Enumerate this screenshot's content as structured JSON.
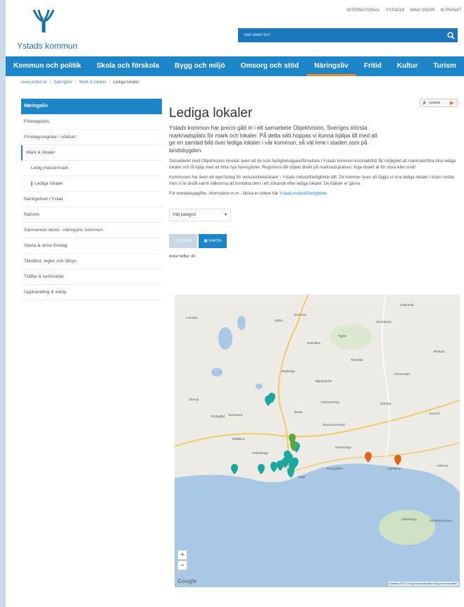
{
  "header": {
    "logo_text": "Ystads kommun",
    "top_links": [
      "INTERNATIONAL",
      "YSTAD24",
      "MINA SIDOR",
      "INTRANAT"
    ],
    "search_placeholder": "Vad söker du?"
  },
  "nav": {
    "items": [
      "Kommun och politik",
      "Skola och förskola",
      "Bygg och miljö",
      "Omsorg och stöd",
      "Näringsliv",
      "Fritid",
      "Kultur",
      "Turism"
    ],
    "active_index": 4
  },
  "breadcrumb": [
    "www.ystad.se",
    "Näringsliv",
    "Mark & lokaler",
    "Lediga lokaler"
  ],
  "sidebar": {
    "heading": "Näringsliv",
    "items": [
      {
        "label": "Företagslots",
        "level": 0
      },
      {
        "label": "Företagsregister / sökbart",
        "level": 0
      },
      {
        "label": "Mark & lokaler",
        "level": 0,
        "open": true
      },
      {
        "label": "Ledig industrimark",
        "level": 1
      },
      {
        "label": "Lediga lokaler",
        "level": 1,
        "active": true
      },
      {
        "label": "Näringslivet i Ystad",
        "level": 0
      },
      {
        "label": "Nätverk",
        "level": 0
      },
      {
        "label": "Samverkan skola - näringsliv- kommun",
        "level": 0
      },
      {
        "label": "Starta & driva företag",
        "level": 0
      },
      {
        "label": "Tillstånd, regler och tillsyn",
        "level": 0
      },
      {
        "label": "Träffar & seminarier",
        "level": 0
      },
      {
        "label": "Upphandling & inköp",
        "level": 0
      }
    ]
  },
  "main": {
    "listen_label": "Lyssna",
    "title": "Lediga lokaler",
    "lead": "Ystads kommun har precis gått in i ett samarbete Objektvision, Sveriges största marknadsplats för mark och lokaler. På detta sätt hoppas vi kunna hjälpa till med att ge en samlad bild över lediga lokaler i vår kommun, så väl inne i staden som på landsbygden.",
    "para1": "Samarbetet med Objektvision innebär även att du som fastighetsägare/förvaltare i Ystads kommun kostnadsfritt får möjlighet att marknadsföra dina lediga lokaler och få hjälp med att hitta nya hyresgäster. Registrera ditt objekt direkt på marknadsplatsen. Inga objekt är för stora eller små!",
    "para2": "Kommunen har även ett eget bolag för verksamhetslokaler - Ystads Industrifastigheter AB. De kommer även att lägga ut sina lediga lokaler i listan nedan men ni är ändå varmt välkomna att kontakta dem i ert sökande efter lediga lokaler. De hjälper er gärna.",
    "para3_text": "För kontaktuppgifter, information m.m - klicka er vidare här",
    "para3_link": "Ystads Industrifastigheter.",
    "select_value": "Välj kategori",
    "btn_lista": "LISTA",
    "btn_karta": "KARTA",
    "count_text": "Antal träffar: 40"
  },
  "map": {
    "labels": [
      "Onslunda",
      "Tomelilla",
      "Brösarp",
      "Sjöbo",
      "Ramsåsa",
      "Lunnarp",
      "Tyghe",
      "Kverrestad",
      "Smedstorp",
      "Baldringe",
      "Bjärsjöholm",
      "Östraby",
      "Everöd",
      "Hammenhög",
      "Hedeskoga",
      "Ystad",
      "Glemminge",
      "Ingelstorp",
      "Kåseberga",
      "Löderup",
      "Svenstorp",
      "Skurup",
      "Rydsgård",
      "Balkåkra",
      "Köpingebro",
      "Sandhammaren",
      "Stora Herrestad",
      "Borrie",
      "Bromma"
    ],
    "zoom_in": "+",
    "zoom_out": "−",
    "google_label": "Google",
    "copyright": "Kartdata ©2017 Google   Användarvillkor   Rapportera ett kartfel"
  },
  "colors": {
    "brand_blue": "#1c86c8",
    "accent_orange": "#e58c2a",
    "marker_teal": "#1aa8a0",
    "marker_green": "#5aa83a",
    "marker_orange": "#e0621d",
    "sea": "#a9c8e6"
  }
}
